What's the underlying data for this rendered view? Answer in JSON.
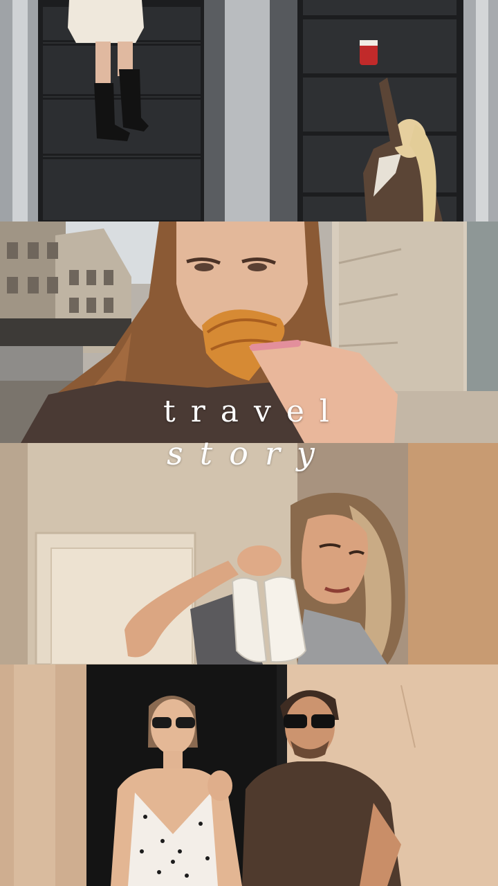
{
  "title": {
    "line1": "travel",
    "line2": "story"
  },
  "scenes": [
    {
      "name": "escalator-scene"
    },
    {
      "name": "croissant-selfie-scene"
    },
    {
      "name": "shoe-photo-scene"
    },
    {
      "name": "couple-portrait-scene"
    }
  ]
}
